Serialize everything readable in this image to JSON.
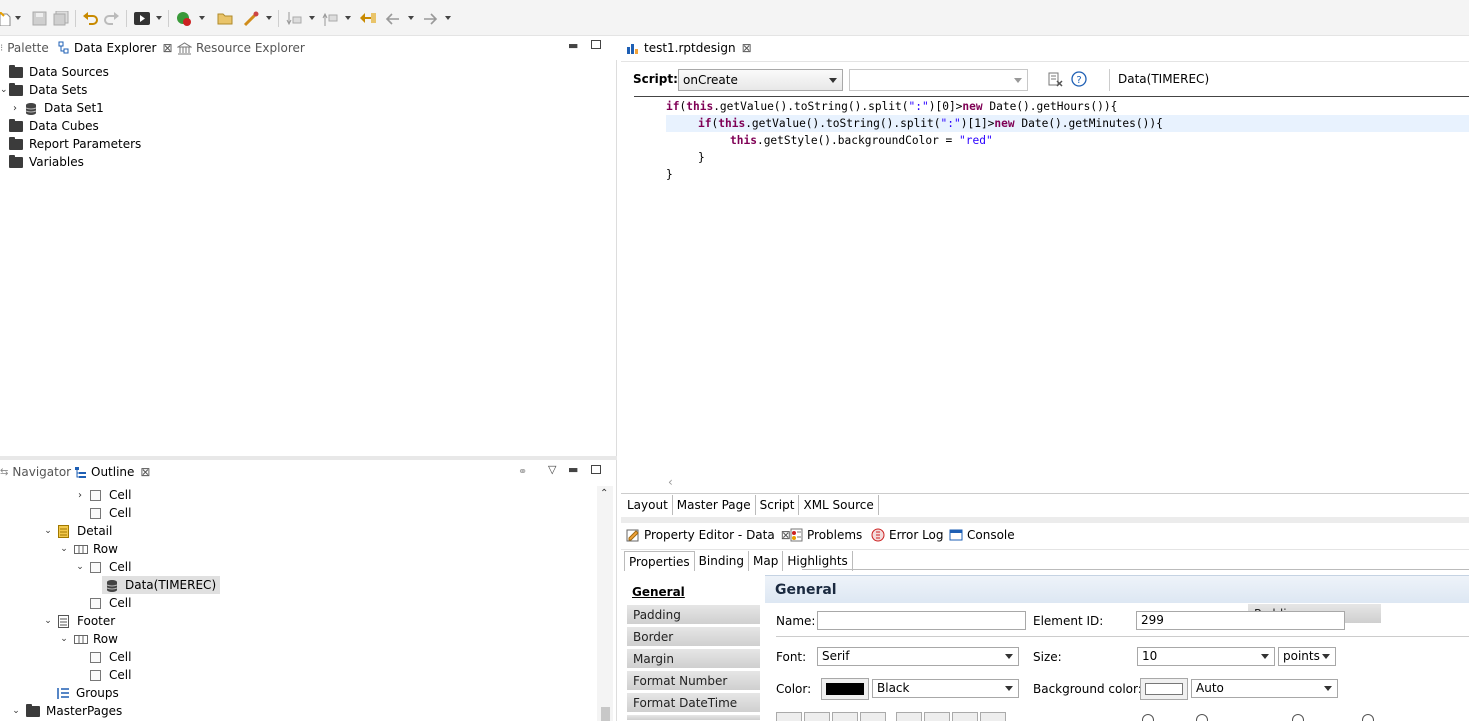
{
  "left_top": {
    "tabs": [
      {
        "label": "Palette",
        "icon": "palette-icon"
      },
      {
        "label": "Data Explorer",
        "icon": "data-explorer-icon"
      },
      {
        "label": "Resource Explorer",
        "icon": "resource-explorer-icon"
      }
    ],
    "tree": [
      {
        "label": "Data Sources"
      },
      {
        "label": "Data Sets"
      },
      {
        "label": "Data Set1"
      },
      {
        "label": "Data Cubes"
      },
      {
        "label": "Report Parameters"
      },
      {
        "label": "Variables"
      }
    ]
  },
  "left_bottom": {
    "tabs": [
      {
        "label": "Navigator"
      },
      {
        "label": "Outline"
      }
    ],
    "tree": [
      {
        "label": "Cell"
      },
      {
        "label": "Cell"
      },
      {
        "label": "Detail"
      },
      {
        "label": "Row"
      },
      {
        "label": "Cell"
      },
      {
        "label": "Data(TIMEREC)"
      },
      {
        "label": "Cell"
      },
      {
        "label": "Footer"
      },
      {
        "label": "Row"
      },
      {
        "label": "Cell"
      },
      {
        "label": "Cell"
      },
      {
        "label": "Groups"
      },
      {
        "label": "MasterPages"
      }
    ]
  },
  "editor": {
    "tab_label": "test1.rptdesign",
    "script_label": "Script:",
    "script_event": "onCreate",
    "script_method": "",
    "element_label": "Data(TIMEREC)",
    "code": {
      "l1_kw1": "if",
      "l1_p1": "(",
      "l1_kw2": "this",
      "l1_p2": ".getValue().toString().split(",
      "l1_s1": "\":\"",
      "l1_p3": ")[0]>",
      "l1_kw3": "new",
      "l1_p4": " Date().getHours()){",
      "l2_kw1": "if",
      "l2_p1": "(",
      "l2_kw2": "this",
      "l2_p2": ".getValue().toString().split(",
      "l2_s1": "\":\"",
      "l2_p3": ")[1]>",
      "l2_kw3": "new",
      "l2_p4": " Date().getMinutes()){",
      "l3_kw1": "this",
      "l3_p1": ".getStyle().backgroundColor = ",
      "l3_s1": "\"red\"",
      "l4": "}",
      "l5": "}"
    },
    "bottom_tabs": [
      "Layout",
      "Master Page",
      "Script",
      "XML Source"
    ]
  },
  "property_panel": {
    "tabs": [
      "Property Editor - Data",
      "Problems",
      "Error Log",
      "Console"
    ],
    "subtabs": [
      "Properties",
      "Binding",
      "Map",
      "Highlights"
    ],
    "categories": [
      "General",
      "Padding",
      "Border",
      "Margin",
      "Format Number",
      "Format DateTime"
    ],
    "section_title": "General",
    "name_label": "Name:",
    "name_value": "",
    "element_id_label": "Element ID:",
    "element_id_value": "299",
    "font_label": "Font:",
    "font_value": "Serif",
    "size_label": "Size:",
    "size_value": "10",
    "size_unit": "points",
    "color_label": "Color:",
    "color_value": "Black",
    "bg_color_label": "Background color:",
    "bg_color_value": "Auto"
  },
  "colors": {
    "keyword": "#7f0055",
    "string": "#2a00ff",
    "accent": "#0b5cad"
  }
}
